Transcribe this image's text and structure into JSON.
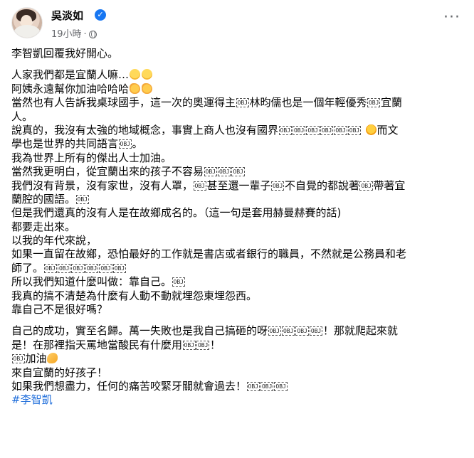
{
  "post": {
    "author": "吳淡如",
    "time": "19小時",
    "separator": "·",
    "more_label": "···"
  },
  "obj": "OBJ",
  "text": {
    "p1": "李智凱回覆我好開心。",
    "l1": "人家我們都是宜蘭人嘛…",
    "l2": "阿姨永遠幫你加油哈哈哈",
    "l3a": "當然也有人告訴我桌球國手，這一次的奧運得主",
    "l3b": "林昀儒也是一個年輕優秀",
    "l3c": "宜蘭",
    "l4": "人。",
    "l5a": "說真的，我沒有太強的地域概念，事實上商人也沒有國界",
    "l5b": "而文",
    "l6a": "學也是世界的共同語言",
    "l6b": "。",
    "l7": "我為世界上所有的傑出人士加油。",
    "l8": "當然我更明白，從宜蘭出來的孩子不容易",
    "l9a": "我們沒有背景，沒有家世，沒有人罩，",
    "l9b": "甚至還一輩子",
    "l9c": "不自覺的都說著",
    "l9d": "帶著宜",
    "l10": "蘭腔的國語。",
    "l11": "但是我們還真的沒有人是在故鄉成名的。（這一句是套用赫曼赫賽的話)",
    "l12": "都要走出來。",
    "l13": "以我的年代來說，",
    "l14": "如果一直留在故鄉，恐怕最好的工作就是書店或者銀行的職員，不然就是公務員和老",
    "l15": "師了。",
    "l16": "所以我們知道什麼叫做：靠自己。",
    "l17": "我真的搞不清楚為什麼有人動不動就埋怨東埋怨西。",
    "l18": "靠自己不是很好嗎？",
    "l19a": "自己的成功，實至名歸。萬一失敗也是我自己搞砸的呀",
    "l19b": "！那就爬起來就",
    "l20a": "是！在那裡指天罵地當酸民有什麼用",
    "l20b": "！",
    "l21": "加油",
    "l22": "來自宜蘭的好孩子！",
    "l23": "如果我們想盡力，任何的痛苦咬緊牙關就會過去！",
    "hashtag": "#李智凱"
  }
}
